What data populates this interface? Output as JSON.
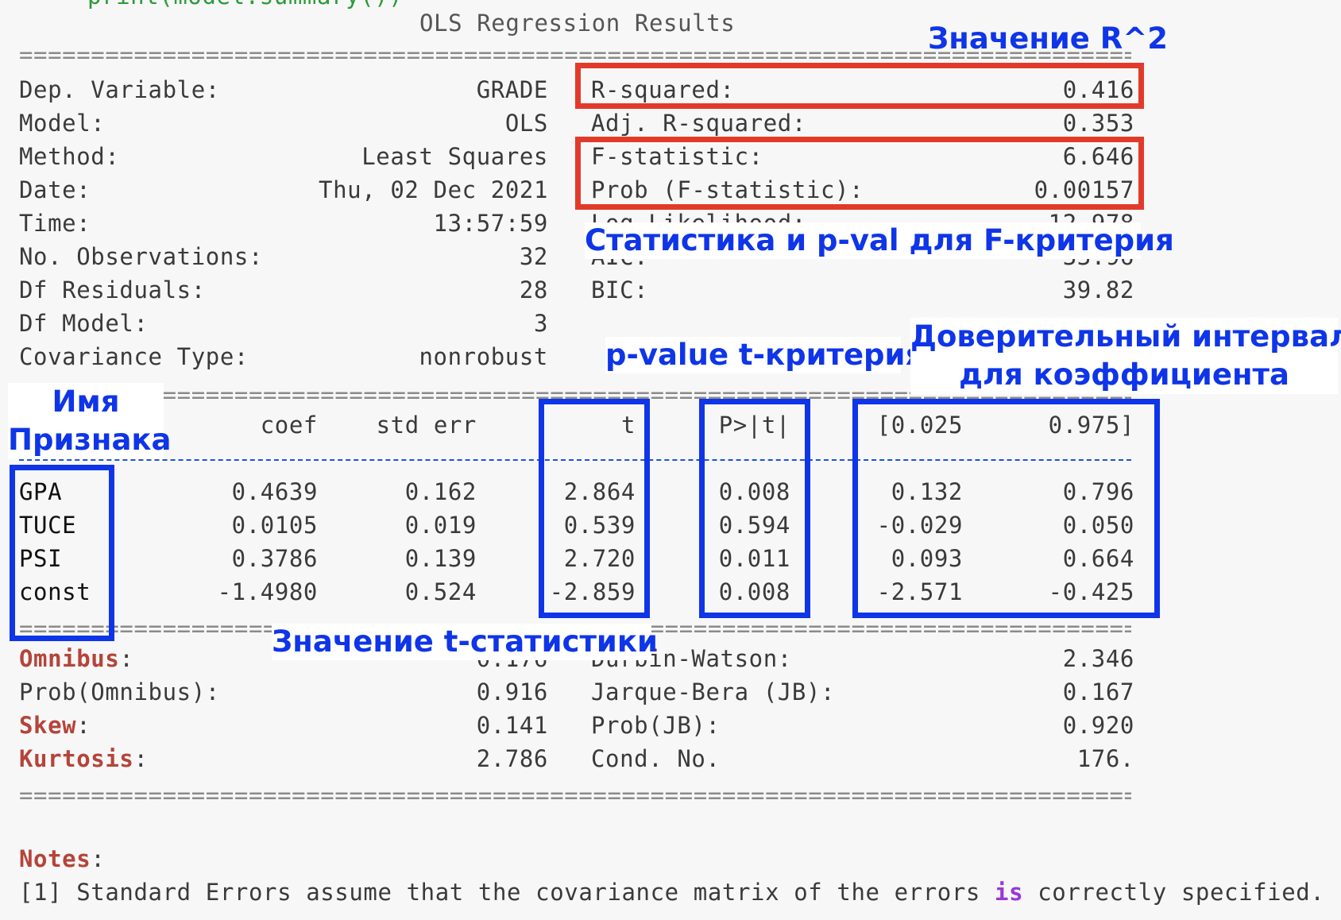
{
  "top_code_fragment": "print(model.summary())",
  "title": "OLS Regression Results",
  "separator_eq": "================================================================================================",
  "header_left": [
    {
      "label": "Dep. Variable:",
      "value": "GRADE"
    },
    {
      "label": "Model:",
      "value": "OLS"
    },
    {
      "label": "Method:",
      "value": "Least Squares"
    },
    {
      "label": "Date:",
      "value": "Thu, 02 Dec 2021"
    },
    {
      "label": "Time:",
      "value": "13:57:59"
    },
    {
      "label": "No. Observations:",
      "value": "32"
    },
    {
      "label": "Df Residuals:",
      "value": "28"
    },
    {
      "label": "Df Model:",
      "value": "3"
    },
    {
      "label": "Covariance Type:",
      "value": "nonrobust"
    }
  ],
  "header_right": [
    {
      "label": "R-squared:",
      "value": "0.416"
    },
    {
      "label": "Adj. R-squared:",
      "value": "0.353"
    },
    {
      "label": "F-statistic:",
      "value": "6.646"
    },
    {
      "label": "Prob (F-statistic):",
      "value": "0.00157"
    },
    {
      "label": "Log-Likelihood:",
      "value": "-12.978"
    },
    {
      "label": "AIC:",
      "value": "33.96"
    },
    {
      "label": "BIC:",
      "value": "39.82"
    }
  ],
  "coef_header": {
    "coef": "coef",
    "std_err": "std err",
    "t": "t",
    "p": "P>|t|",
    "lo": "[0.025",
    "hi": "0.975]"
  },
  "coef_rows": [
    {
      "name": "GPA",
      "coef": "0.4639",
      "std_err": "0.162",
      "t": "2.864",
      "p": "0.008",
      "lo": "0.132",
      "hi": "0.796"
    },
    {
      "name": "TUCE",
      "coef": "0.0105",
      "std_err": "0.019",
      "t": "0.539",
      "p": "0.594",
      "lo": "-0.029",
      "hi": "0.050"
    },
    {
      "name": "PSI",
      "coef": "0.3786",
      "std_err": "0.139",
      "t": "2.720",
      "p": "0.011",
      "lo": "0.093",
      "hi": "0.664"
    },
    {
      "name": "const",
      "coef": "-1.4980",
      "std_err": "0.524",
      "t": "-2.859",
      "p": "0.008",
      "lo": "-2.571",
      "hi": "-0.425"
    }
  ],
  "diag_left": [
    {
      "label": "Omnibus",
      "suffix": ":",
      "value": "0.176",
      "highlight": true
    },
    {
      "label": "Prob(Omnibus):",
      "suffix": "",
      "value": "0.916",
      "highlight": false
    },
    {
      "label": "Skew",
      "suffix": ":",
      "value": "0.141",
      "highlight": true
    },
    {
      "label": "Kurtosis",
      "suffix": ":",
      "value": "2.786",
      "highlight": true
    }
  ],
  "diag_right": [
    {
      "label": "Durbin-Watson:",
      "value": "2.346"
    },
    {
      "label": "Jarque-Bera (JB):",
      "value": "0.167"
    },
    {
      "label": "Prob(JB):",
      "value": "0.920"
    },
    {
      "label": "Cond. No.",
      "value": "176."
    }
  ],
  "notes": {
    "label": "Notes",
    "colon": ":",
    "line_before": "[1] Standard Errors assume that the covariance matrix of the errors ",
    "keyword": "is",
    "line_after": " correctly specified."
  },
  "annotations": {
    "r2": "Значение R^2",
    "fstat": "Статистика и p-val для F-критерия",
    "pvalue": "p-value t-критерия",
    "ci": "Доверительный интервал\nдля коэффициента",
    "feature": "Имя\nПризнака",
    "tstat": "Значение t-статистики"
  },
  "colors": {
    "red_box": "#e23a2a",
    "blue_box": "#0f35e8",
    "highlight": "#b5443a",
    "keyword": "#9a35d8"
  }
}
